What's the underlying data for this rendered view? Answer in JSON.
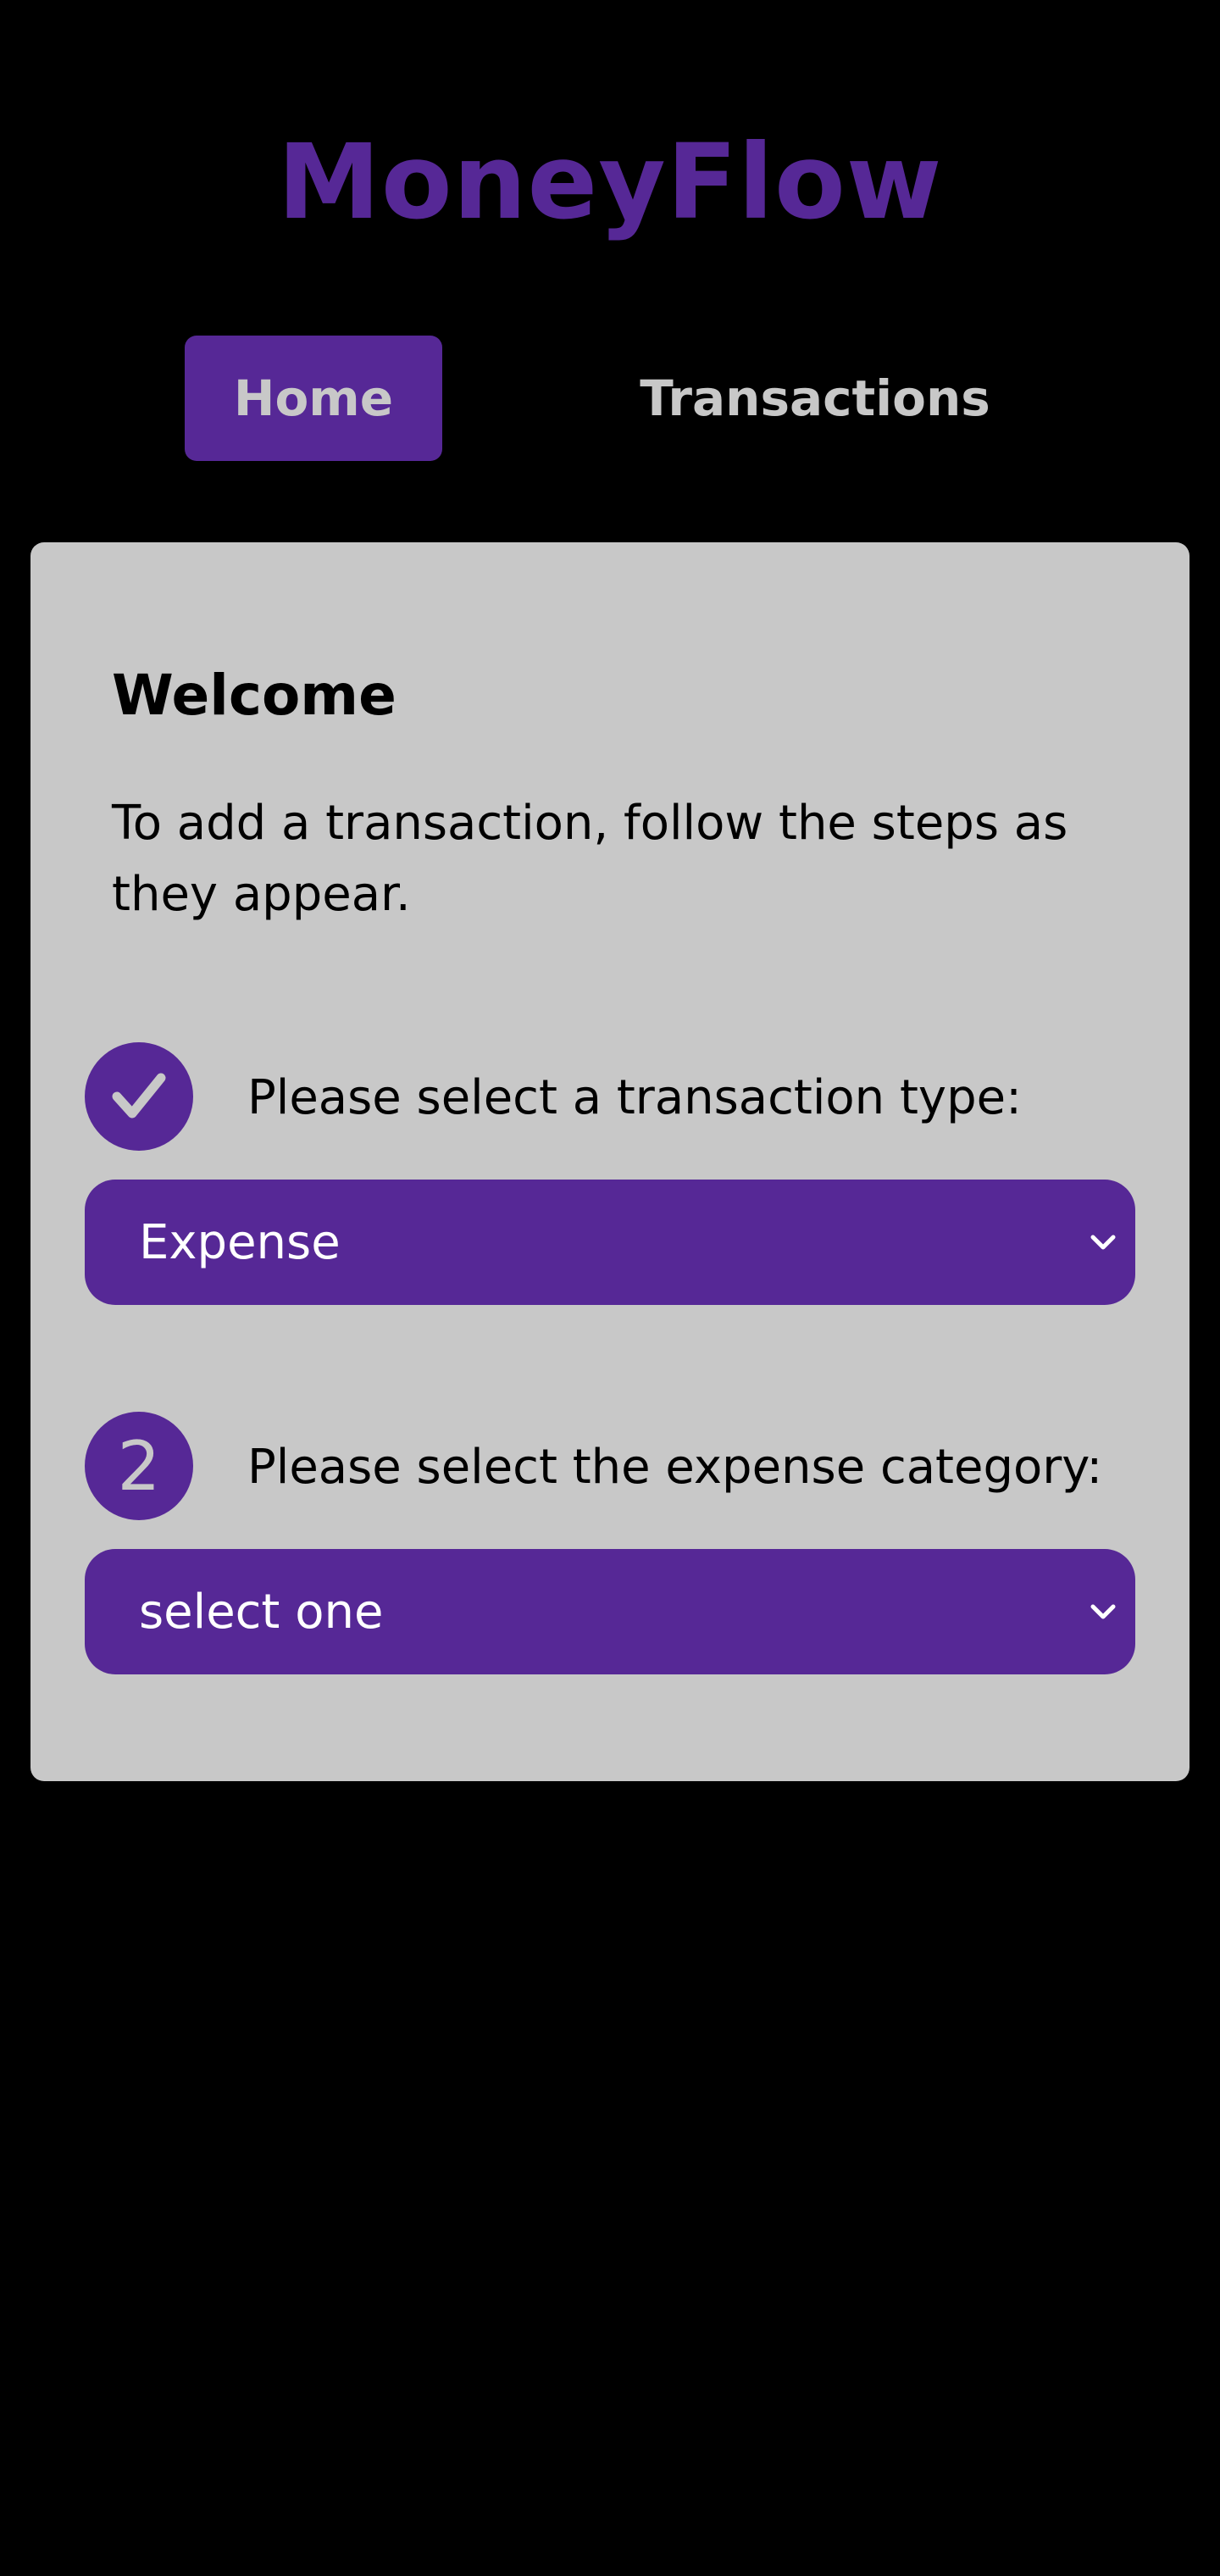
{
  "app": {
    "title": "MoneyFlow"
  },
  "nav": {
    "home_label": "Home",
    "transactions_label": "Transactions",
    "active": "Home"
  },
  "card": {
    "heading": "Welcome",
    "intro": "To add a transaction, follow the steps as they appear."
  },
  "steps": [
    {
      "status": "complete",
      "badge_icon": "check-icon",
      "label": "Please select a transaction type:",
      "select_value": "Expense"
    },
    {
      "status": "current",
      "number": "2",
      "label": "Please select the expense category:",
      "select_value": "select one"
    }
  ],
  "colors": {
    "background": "#000000",
    "accent": "#562896",
    "card": "#c8c8c8",
    "nav_text": "#c8c8c8"
  }
}
